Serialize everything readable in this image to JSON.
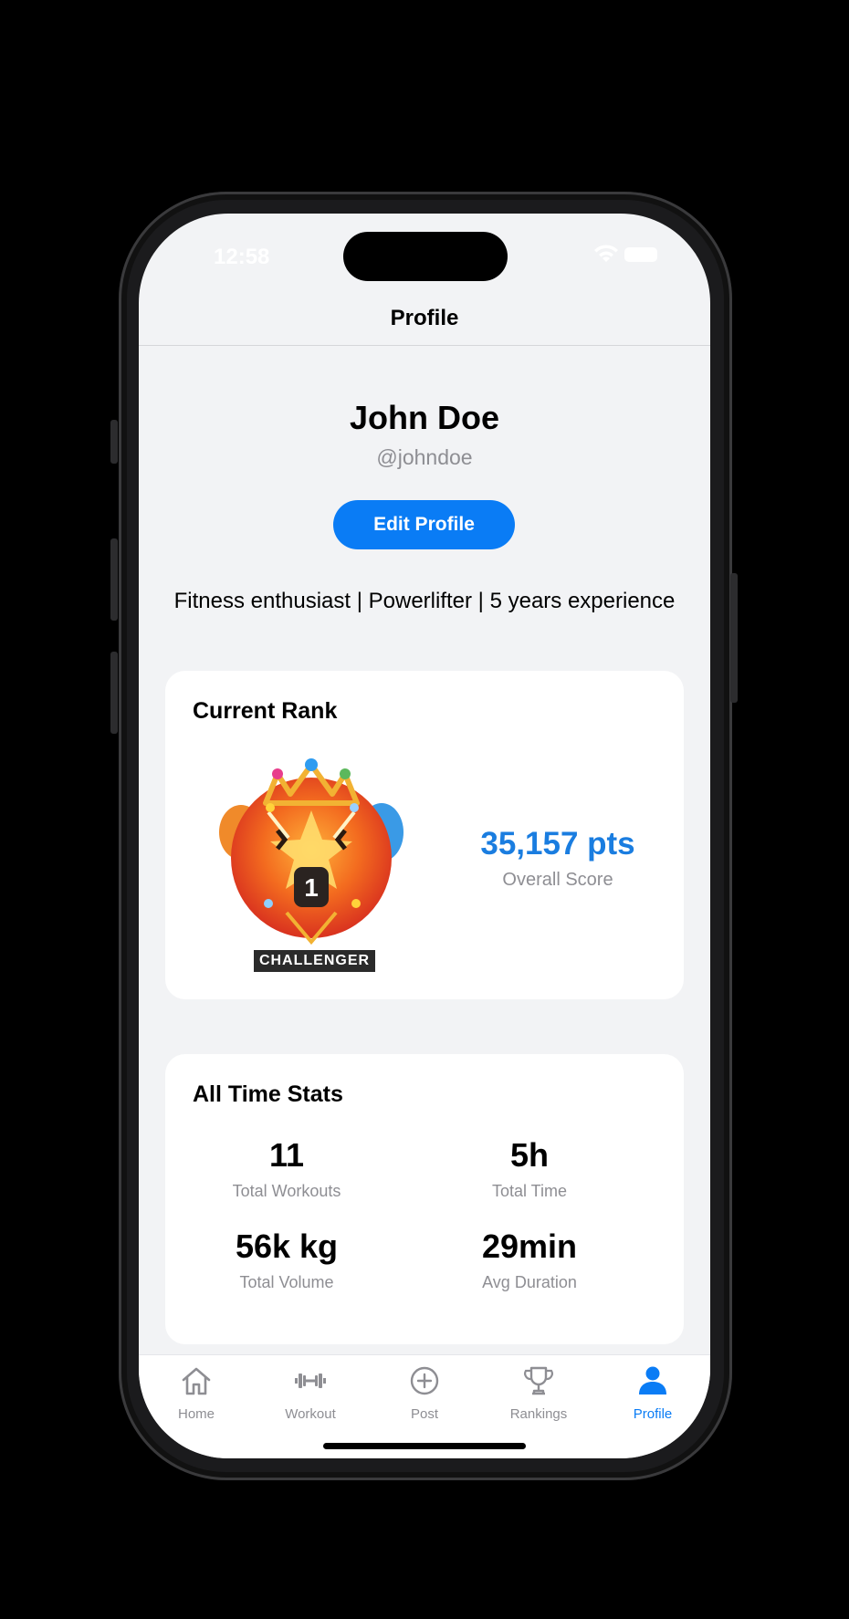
{
  "status_bar": {
    "time": "12:58"
  },
  "navbar": {
    "title": "Profile"
  },
  "profile": {
    "name": "John Doe",
    "handle": "@johndoe",
    "edit_label": "Edit Profile",
    "bio": "Fitness enthusiast | Powerlifter | 5 years experience"
  },
  "rank": {
    "title": "Current Rank",
    "badge_label": "CHALLENGER",
    "badge_number": "1",
    "points": "35,157 pts",
    "points_label": "Overall Score"
  },
  "stats": {
    "title": "All Time Stats",
    "items": [
      {
        "value": "11",
        "label": "Total Workouts"
      },
      {
        "value": "5h",
        "label": "Total Time"
      },
      {
        "value": "56k kg",
        "label": "Total Volume"
      },
      {
        "value": "29min",
        "label": "Avg Duration"
      }
    ]
  },
  "tabbar": {
    "items": [
      {
        "label": "Home",
        "icon": "home-icon"
      },
      {
        "label": "Workout",
        "icon": "dumbbell-icon"
      },
      {
        "label": "Post",
        "icon": "plus-circle-icon"
      },
      {
        "label": "Rankings",
        "icon": "trophy-icon"
      },
      {
        "label": "Profile",
        "icon": "person-icon"
      }
    ],
    "active": "Profile"
  },
  "colors": {
    "accent": "#0a7cf5",
    "points": "#1a7de0",
    "background": "#f2f3f5",
    "muted_text": "#8e8e93"
  }
}
